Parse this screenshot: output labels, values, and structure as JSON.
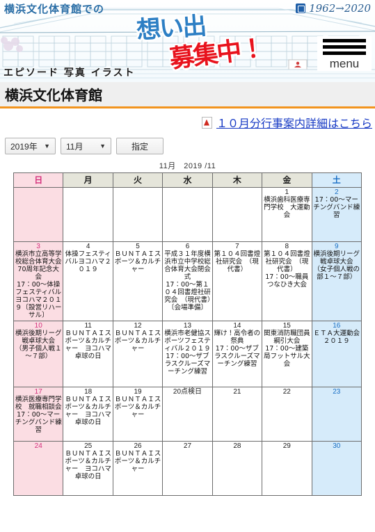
{
  "banner": {
    "top_text": "横浜文化体育館での",
    "memories_word": "想い出",
    "recruit_word": "募集中！",
    "keywords": "エピソード 写真 イラスト",
    "years_badge": "1962→2020",
    "years_icon": "building-badge-icon",
    "menu_label": "menu",
    "menu_icon": "hamburger-icon"
  },
  "site": {
    "title": "横浜文化体育館"
  },
  "pdf_link": {
    "icon": "pdf-file-icon",
    "text": "１０月分行事案内詳細はこちら"
  },
  "controls": {
    "year": "2019年",
    "month": "11月",
    "submit_label": "指定",
    "dropdown_icon": "chevron-down-icon"
  },
  "calendar": {
    "caption": "11月　2019 /11",
    "weekday_headers": [
      "日",
      "月",
      "火",
      "水",
      "木",
      "金",
      "土"
    ],
    "weeks": [
      [
        {
          "day": "",
          "events": []
        },
        {
          "day": "",
          "events": []
        },
        {
          "day": "",
          "events": []
        },
        {
          "day": "",
          "events": []
        },
        {
          "day": "",
          "events": []
        },
        {
          "day": "1",
          "events": [
            "横浜歯科医療専門学校　大運動会"
          ]
        },
        {
          "day": "2",
          "events": [
            "17：00～マーチングバンド練習"
          ]
        }
      ],
      [
        {
          "day": "3",
          "events": [
            "横浜市立高等学校総合体育大会70周年記念大会",
            "17：00～体操フェスティバルヨコハマ２０１９〔設営リハーサル〕"
          ]
        },
        {
          "day": "4",
          "events": [
            "体操フェスティバルヨコハマ２０１９"
          ]
        },
        {
          "day": "5",
          "events": [
            "ＢＵＮＴＡＩスポーツ＆カルチャー"
          ]
        },
        {
          "day": "6",
          "events": [
            "平成３１年度横浜市立中学校総合体育大会閉会式",
            "17：00～第１０４回書燈社研究会　（現代書）〔会場準備〕"
          ]
        },
        {
          "day": "7",
          "events": [
            "第１０４回書燈社研究会　（現代書）"
          ]
        },
        {
          "day": "8",
          "events": [
            "第１０４回書燈社研究会　（現代書）",
            "17：00～職員つなひき大会"
          ]
        },
        {
          "day": "9",
          "events": [
            "横浜後期リーグ戦卓球大会　（女子個人戦の部１～７部）"
          ]
        }
      ],
      [
        {
          "day": "10",
          "events": [
            "横浜後期リーグ戦卓球大会　（男子個人戦１～７部）"
          ]
        },
        {
          "day": "11",
          "events": [
            "ＢＵＮＴＡＩスポーツ＆カルチャー　ヨコハマ卓球の日"
          ]
        },
        {
          "day": "12",
          "events": [
            "ＢＵＮＴＡＩスポーツ＆カルチャー"
          ]
        },
        {
          "day": "13",
          "events": [
            "横浜市老健協スポーツフェスティバル２０１９",
            "17：00～ザブラスクルーズマーチング練習"
          ]
        },
        {
          "day": "14",
          "events": [
            "輝け！高令者の祭典",
            "17：00～ザブラスクルーズマーチング練習"
          ]
        },
        {
          "day": "15",
          "events": [
            "関東消防職団員綱引大会",
            "17：00～建築局フットサル大会"
          ]
        },
        {
          "day": "16",
          "events": [
            "ＥＴＡ大運動会２０１９"
          ]
        }
      ],
      [
        {
          "day": "17",
          "events": [
            "横浜医療専門学校　就職相談会",
            "17：00～マーチングバンド練習"
          ]
        },
        {
          "day": "18",
          "events": [
            "ＢＵＮＴＡＩスポーツ＆カルチャー　ヨコハマ卓球の日"
          ]
        },
        {
          "day": "19",
          "events": [
            "ＢＵＮＴＡＩスポーツ＆カルチャー"
          ]
        },
        {
          "day": "20",
          "events": [
            "点検日"
          ],
          "inline": true
        },
        {
          "day": "21",
          "events": []
        },
        {
          "day": "22",
          "events": []
        },
        {
          "day": "23",
          "events": []
        }
      ],
      [
        {
          "day": "24",
          "events": []
        },
        {
          "day": "25",
          "events": [
            "ＢＵＮＴＡＩスポーツ＆カルチャー　ヨコハマ卓球の日"
          ]
        },
        {
          "day": "26",
          "events": [
            "ＢＵＮＴＡＩスポーツ＆カルチャー"
          ]
        },
        {
          "day": "27",
          "events": []
        },
        {
          "day": "28",
          "events": []
        },
        {
          "day": "29",
          "events": []
        },
        {
          "day": "30",
          "events": []
        }
      ]
    ]
  }
}
